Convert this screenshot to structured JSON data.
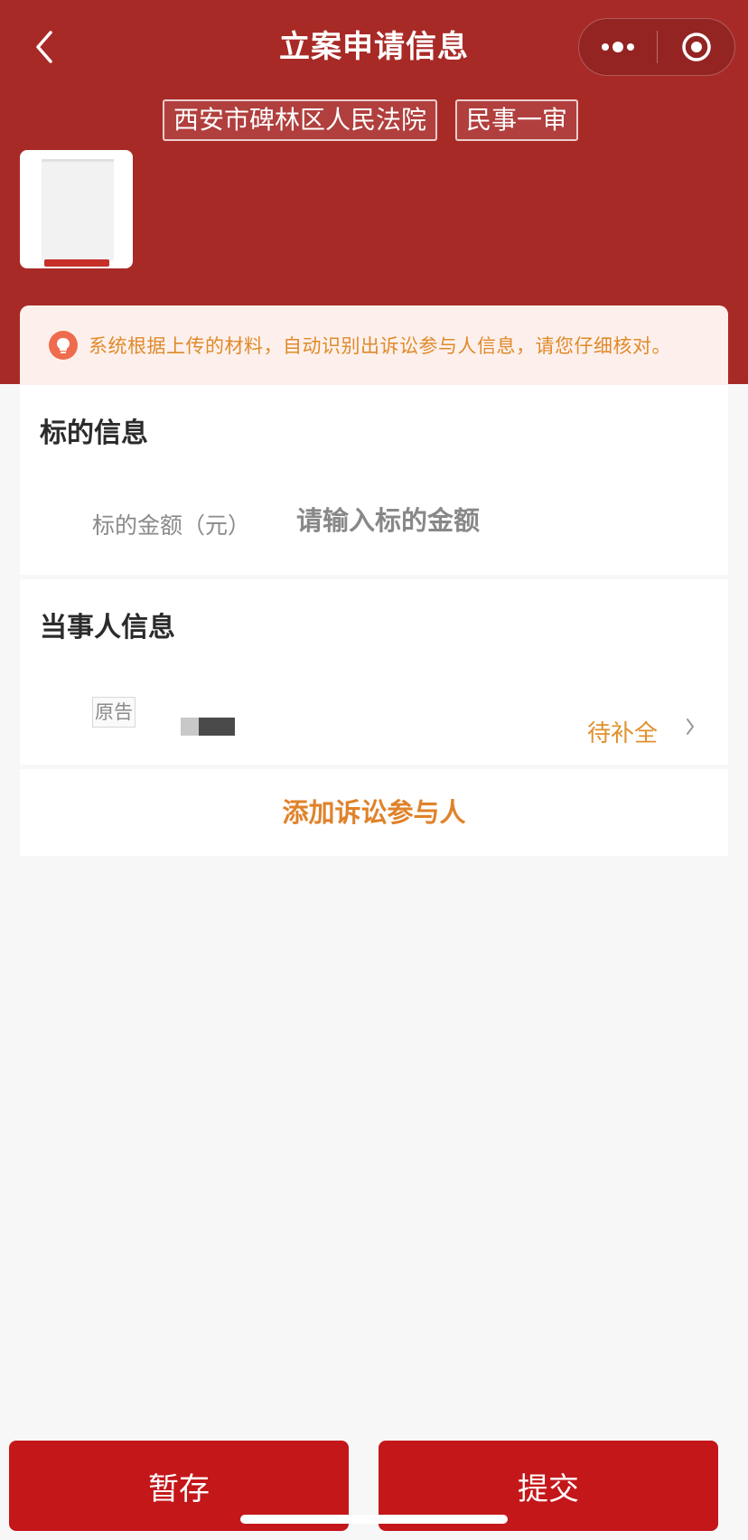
{
  "header": {
    "title": "立案申请信息",
    "tags": [
      "西安市碑林区人民法院",
      "民事一审"
    ],
    "background_color": "#a82a27"
  },
  "notice": {
    "text": "系统根据上传的材料，自动识别出诉讼参与人信息，请您仔细核对。",
    "icon": "lightbulb-icon"
  },
  "subject_section": {
    "title": "标的信息",
    "amount_label": "标的金额（元）",
    "amount_placeholder": "请输入标的金额",
    "amount_value": ""
  },
  "party_section": {
    "title": "当事人信息",
    "parties": [
      {
        "role": "原告",
        "status": "待补全"
      }
    ]
  },
  "add_participant_label": "添加诉讼参与人",
  "footer": {
    "save_label": "暂存",
    "submit_label": "提交",
    "button_color": "#c4171a"
  }
}
